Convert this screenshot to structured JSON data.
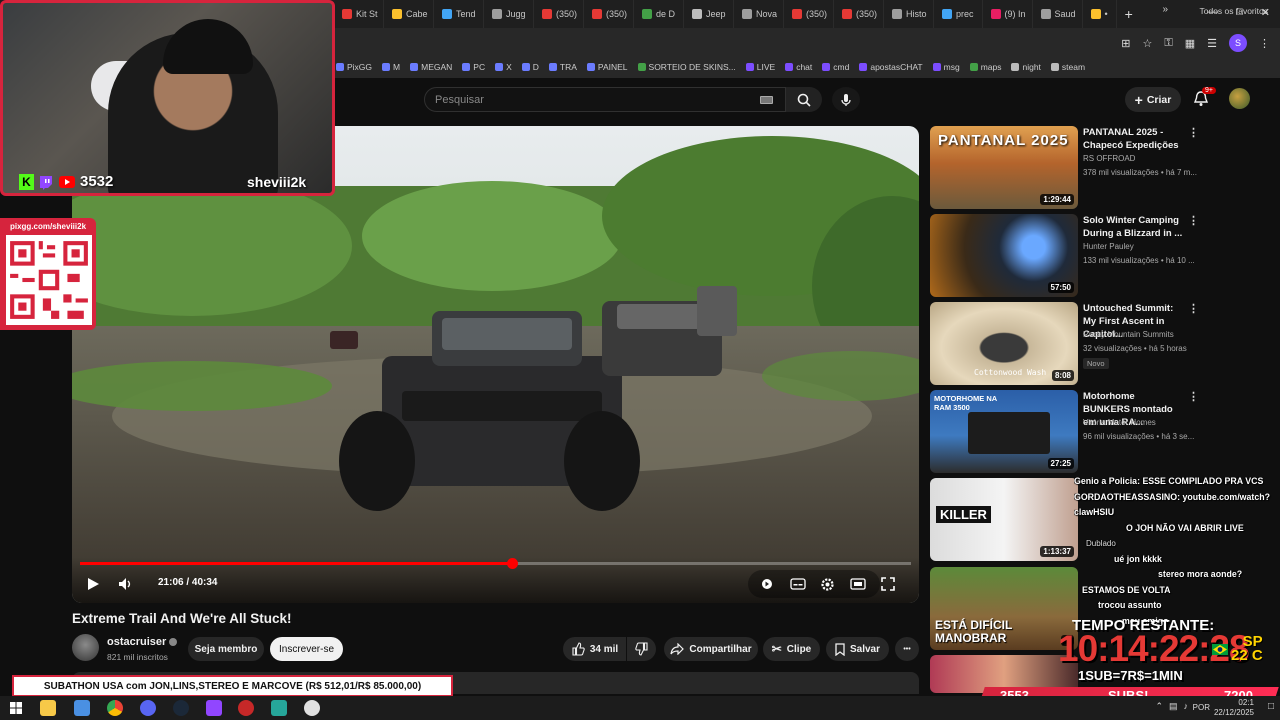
{
  "browser": {
    "tabs": [
      "Kit St",
      "Cabe",
      "Tend",
      "Jugg",
      "(350)",
      "(350)",
      "de D",
      "Jeep",
      "Nova",
      "(350)",
      "(350)",
      "Histo",
      "prec",
      "(9) In",
      "Saud",
      "•"
    ],
    "tab_colors": [
      "#e53935",
      "#fbc02d",
      "#42a5f5",
      "#9e9e9e",
      "#e53935",
      "#e53935",
      "#43a047",
      "#bdbdbd",
      "#9e9e9e",
      "#e53935",
      "#e53935",
      "#9e9e9e",
      "#42a5f5",
      "#e91e63",
      "#9e9e9e",
      "#fbc02d"
    ],
    "new_tab": "+",
    "profile_initial": "S",
    "bookmarks": [
      "PixGG",
      "M",
      "MEGAN",
      "PC",
      "X",
      "D",
      "TRA",
      "PAINEL",
      "SORTEIO DE SKINS...",
      "LIVE",
      "chat",
      "cmd",
      "apostasCHAT",
      "msg",
      "maps",
      "night",
      "steam"
    ],
    "bookmarks_more": "»",
    "bookmarks_all": "Todos os favoritos"
  },
  "header": {
    "search_placeholder": "Pesquisar",
    "create_label": "Criar",
    "notif_count": "9+"
  },
  "player": {
    "current_time": "21:06",
    "duration": "40:34",
    "time_display": "21:06 / 40:34",
    "progress": 0.52
  },
  "video": {
    "title": "Extreme Trail And We're All Stuck!",
    "channel": "ostacruiser",
    "subscribers": "821 mil inscritos",
    "member_label": "Seja membro",
    "subscribe_label": "Inscrever-se",
    "likes": "34 mil",
    "share_label": "Compartilhar",
    "clip_label": "Clipe",
    "save_label": "Salvar",
    "more": "•••"
  },
  "recommended": [
    {
      "title": "PANTANAL 2025 - Chapecó Expedições",
      "channel": "RS OFFROAD",
      "meta": "378 mil visualizações • há 7 m...",
      "duration": "1:29:44",
      "badge": "",
      "thumb_text": "PANTANAL 2025"
    },
    {
      "title": "Solo Winter Camping During a Blizzard in ...",
      "channel": "Hunter Pauley",
      "meta": "133 mil visualizações • há 10 ...",
      "duration": "57:50",
      "badge": "",
      "thumb_text": ""
    },
    {
      "title": "Untouched Summit: My First Ascent in Capitol...",
      "channel": "Rocky Mountain Summits",
      "meta": "32 visualizações • há 5 horas",
      "duration": "8:08",
      "badge": "Novo",
      "thumb_text": "Cottonwood Wash"
    },
    {
      "title": "Motorhome BUNKERS montado em uma RA...",
      "channel": "Vitória Motor Homes",
      "meta": "96 mil visualizações • há 3 se...",
      "duration": "27:25",
      "badge": "",
      "thumb_text": "MOTORHOME NA RAM 3500"
    },
    {
      "title": "",
      "channel": "",
      "meta": "",
      "duration": "1:13:37",
      "badge": "",
      "thumb_text": "KILLER"
    },
    {
      "title": "",
      "channel": "",
      "meta": "",
      "duration": "3:",
      "badge": "",
      "thumb_text": "ESTÁ DIFÍCIL MANOBRAR"
    },
    {
      "title": "",
      "channel": "",
      "meta": "",
      "duration": "",
      "badge": "",
      "thumb_text": ""
    }
  ],
  "stream": {
    "viewer_count": "3532",
    "streamer": "sheviii2k",
    "pix_url": "pixgg.com/sheviii2k",
    "chat": [
      "Genio a Policia: ESSE COMPILADO PRA VCS",
      "GORDAOTHEASSASINO: youtube.com/watch?",
      "clawHSIU",
      "O JOH NÃO VAI ABRIR LIVE",
      "Dublado",
      "ué jon kkkk",
      "stereo mora aonde?",
      "ESTAMOS DE VOLTA",
      "trocou assunto",
      "meu amigo"
    ],
    "timer_label": "TEMPO RESTANTE:",
    "timer": "10:14:22:28",
    "weather": "SP\n22 C",
    "weather_city": "SP",
    "weather_temp": "22 C",
    "sub_goal": "1SUB=7R$=1MIN",
    "subathon": "SUBATHON USA com JON,LINS,STEREO E MARCOVE (R$ 512,01/R$ 85.000,00)",
    "counter_left": "3553",
    "counter_mid": "SUBS!",
    "counter_right": "7200"
  },
  "taskbar": {
    "lang": "POR",
    "time": "02:1",
    "date": "22/12/2025"
  },
  "colors": {
    "accent": "#f00",
    "overlay_red": "#d6243d",
    "kick_green": "#53fc18",
    "timer_red": "#e53935"
  }
}
